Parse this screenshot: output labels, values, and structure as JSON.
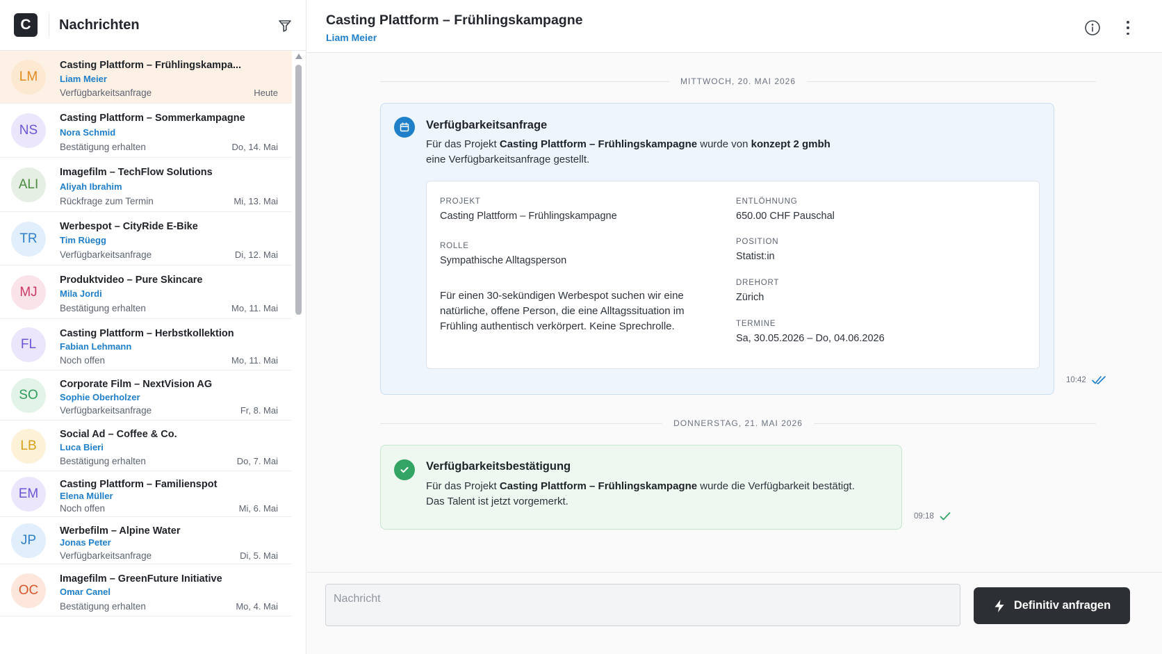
{
  "sidebar": {
    "logo_letter": "C",
    "title": "Nachrichten",
    "filter_icon": "filter-icon",
    "conversations": [
      {
        "initials": "LM",
        "title": "Casting Plattform – Frühlingskampa...",
        "name": "Liam Meier",
        "status": "Verfügbarkeitsanfrage",
        "date": "Heute",
        "active": true,
        "bg": "#fde8d2",
        "fg": "#e08a1e"
      },
      {
        "initials": "NS",
        "title": "Casting Plattform – Sommerkampagne",
        "name": "Nora Schmid",
        "status": "Bestätigung erhalten",
        "date": "Do, 14. Mai",
        "bg": "#ebe6fb",
        "fg": "#6d55d8"
      },
      {
        "initials": "ALI",
        "title": "Imagefilm – TechFlow Solutions",
        "name": "Aliyah Ibrahim",
        "status": "Rückfrage zum Termin",
        "date": "Mi, 13. Mai",
        "bg": "#e5efe3",
        "fg": "#4a8a3f"
      },
      {
        "initials": "TR",
        "title": "Werbespot – CityRide E-Bike",
        "name": "Tim Rüegg",
        "status": "Verfügbarkeitsanfrage",
        "date": "Di, 12. Mai",
        "bg": "#e1eefb",
        "fg": "#2f7fc9"
      },
      {
        "initials": "MJ",
        "title": "Produktvideo – Pure Skincare",
        "name": "Mila Jordi",
        "status": "Bestätigung erhalten",
        "date": "Mo, 11. Mai",
        "bg": "#fbe3ea",
        "fg": "#cc3a67"
      },
      {
        "initials": "FL",
        "title": "Casting Plattform – Herbstkollektion",
        "name": "Fabian Lehmann",
        "status": "Noch offen",
        "date": "Mo, 11. Mai",
        "bg": "#ebe6fb",
        "fg": "#6d55d8"
      },
      {
        "initials": "SO",
        "title": "Corporate Film – NextVision AG",
        "name": "Sophie Oberholzer",
        "status": "Verfügbarkeitsanfrage",
        "date": "Fr, 8. Mai",
        "bg": "#e2f4e7",
        "fg": "#2f9c5b"
      },
      {
        "initials": "LB",
        "title": "Social Ad – Coffee & Co.",
        "name": "Luca Bieri",
        "status": "Bestätigung erhalten",
        "date": "Do, 7. Mai",
        "bg": "#fdf1d8",
        "fg": "#d9a016"
      },
      {
        "initials": "EM",
        "title": "Casting Plattform – Familienspot",
        "name": "Elena Müller",
        "status": "Noch offen",
        "date": "Mi, 6. Mai",
        "bg": "#ebe6fb",
        "fg": "#6d55d8"
      },
      {
        "initials": "JP",
        "title": "Werbefilm – Alpine Water",
        "name": "Jonas Peter",
        "status": "Verfügbarkeitsanfrage",
        "date": "Di, 5. Mai",
        "bg": "#e1eefb",
        "fg": "#2f7fc9"
      },
      {
        "initials": "OC",
        "title": "Imagefilm – GreenFuture Initiative",
        "name": "Omar Canel",
        "status": "Bestätigung erhalten",
        "date": "Mo, 4. Mai",
        "bg": "#fde6dc",
        "fg": "#d8572a"
      }
    ]
  },
  "header": {
    "title": "Casting Plattform – Frühlingskampagne",
    "subtitle": "Liam Meier"
  },
  "messages": {
    "day1": "MITTWOCH, 20. MAI 2026",
    "request": {
      "title": "Verfügbarkeitsanfrage",
      "text_1": "Für das Projekt ",
      "project": "Casting Plattform – Frühlingskampagne",
      "text_2": " wurde von ",
      "company": "konzept 2 gmbh",
      "text_3": "eine Verfügbarkeitsanfrage gestellt.",
      "time": "10:42",
      "details": {
        "projekt_label": "PROJEKT",
        "projekt_value": "Casting Plattform – Frühlingskampagne",
        "rolle_label": "ROLLE",
        "rolle_value": "Sympathische Alltagsperson",
        "description": "Für einen 30-sekündigen Werbespot suchen wir eine natürliche, offene Person, die eine Alltagssituation im Frühling authentisch verkörpert. Keine Sprechrolle.",
        "entloehnung_label": "ENTLÖHNUNG",
        "entloehnung_value": "650.00 CHF Pauschal",
        "position_label": "POSITION",
        "position_value": "Statist:in",
        "drehort_label": "DREHORT",
        "drehort_value": "Zürich",
        "termine_label": "TERMINE",
        "termine_value": "Sa, 30.05.2026 – Do, 04.06.2026"
      }
    },
    "day2": "DONNERSTAG, 21. MAI 2026",
    "confirmation": {
      "title": "Verfügbarkeitsbestätigung",
      "text_1": "Für das Projekt ",
      "project": "Casting Plattform – Frühlingskampagne",
      "text_2": " wurde die Verfügbarkeit bestätigt.",
      "text_3": "Das Talent ist jetzt vorgemerkt.",
      "time": "09:18"
    }
  },
  "composer": {
    "placeholder": "Nachricht",
    "value": "",
    "send_label": "Definitiv anfragen"
  },
  "colors": {
    "accent_blue": "#1f7fc9",
    "active_row": "#fdf1e6",
    "request_bg": "#eef5fd",
    "confirm_bg": "#eef8f1",
    "confirm_green": "#34a464",
    "button_dark": "#2c2f33"
  }
}
